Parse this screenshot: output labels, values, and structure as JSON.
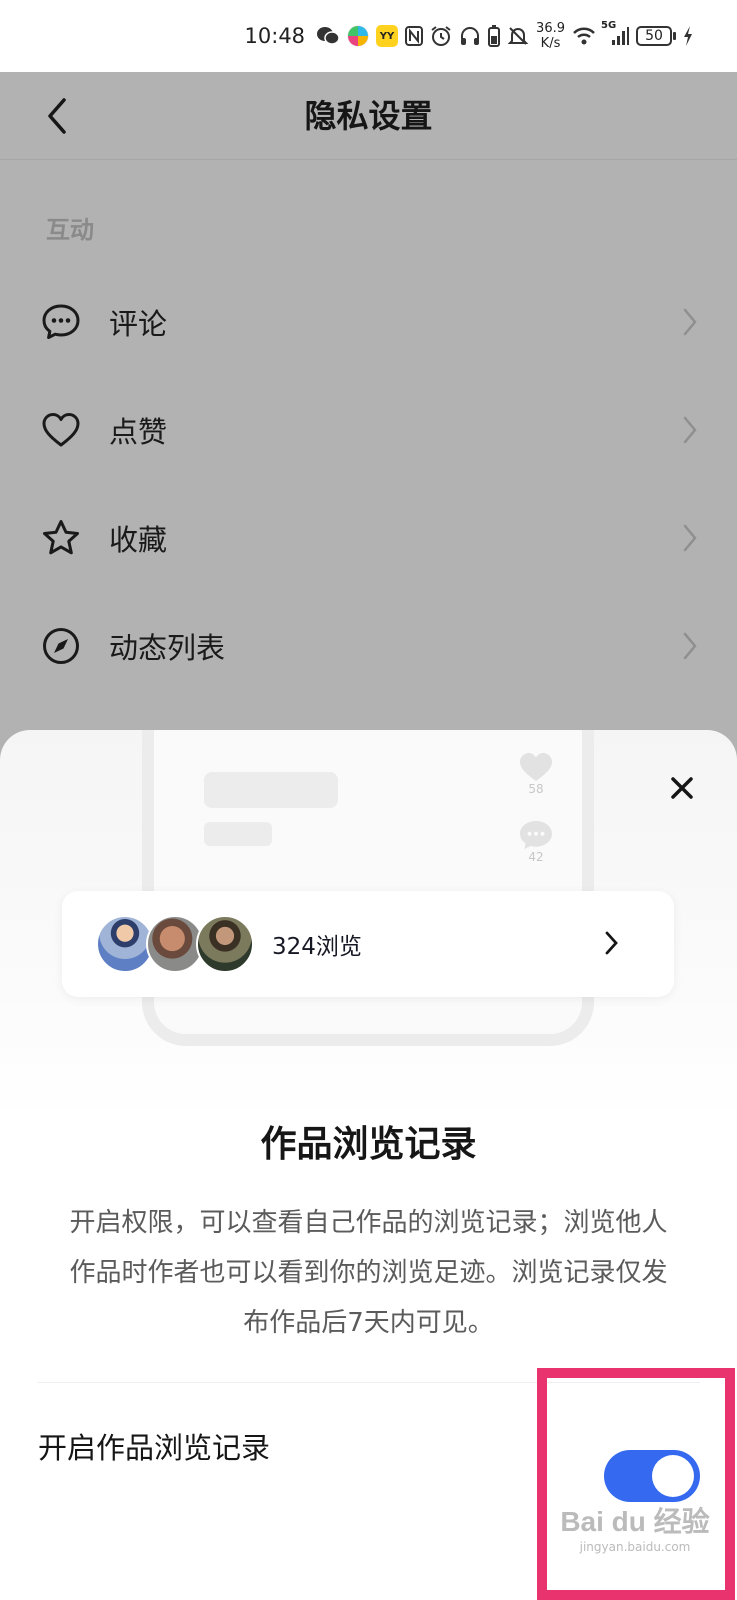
{
  "status_bar": {
    "time": "10:48",
    "speed_value": "36.9",
    "speed_unit": "K/s",
    "network": "5G",
    "battery": "50"
  },
  "nav": {
    "title": "隐私设置"
  },
  "section": {
    "title": "互动"
  },
  "menu_items": [
    {
      "label": "评论",
      "icon": "comment-icon"
    },
    {
      "label": "点赞",
      "icon": "heart-icon"
    },
    {
      "label": "收藏",
      "icon": "star-icon"
    },
    {
      "label": "动态列表",
      "icon": "compass-icon"
    }
  ],
  "sheet": {
    "preview_like_count": "58",
    "preview_comment_count": "42",
    "view_count_text": "324浏览",
    "heading": "作品浏览记录",
    "description": "开启权限，可以查看自己作品的浏览记录；浏览他人作品时作者也可以看到你的浏览足迹。浏览记录仅发布作品后7天内可见。",
    "toggle_label": "开启作品浏览记录",
    "toggle_on": true
  },
  "colors": {
    "accent": "#3469f0",
    "highlight_box": "#e8336f",
    "overlay_bg": "#b2b2b2"
  },
  "watermark": {
    "logo": "Bai du 经验",
    "url": "jingyan.baidu.com"
  }
}
